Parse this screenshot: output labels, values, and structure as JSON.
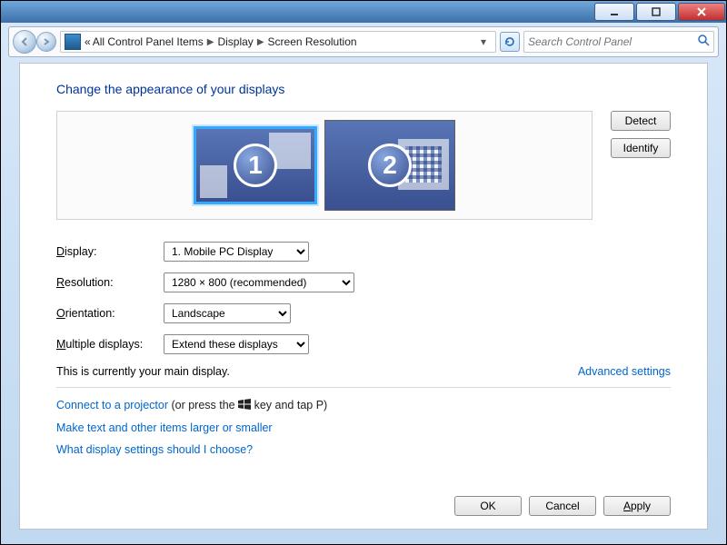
{
  "titlebar": {
    "window_controls": [
      "minimize",
      "maximize",
      "close"
    ]
  },
  "breadcrumb": {
    "prefix": "«",
    "items": [
      "All Control Panel Items",
      "Display",
      "Screen Resolution"
    ]
  },
  "search": {
    "placeholder": "Search Control Panel"
  },
  "heading": "Change the appearance of your displays",
  "preview": {
    "monitors": [
      {
        "id": "1",
        "selected": true
      },
      {
        "id": "2",
        "selected": false
      }
    ],
    "detect_label": "Detect",
    "identify_label": "Identify"
  },
  "form": {
    "display_label": "Display:",
    "display_value": "1. Mobile PC Display",
    "resolution_label": "Resolution:",
    "resolution_value": "1280 × 800 (recommended)",
    "orientation_label": "Orientation:",
    "orientation_value": "Landscape",
    "multiple_label": "Multiple displays:",
    "multiple_value": "Extend these displays"
  },
  "status": {
    "main_display_text": "This is currently your main display.",
    "advanced_link": "Advanced settings"
  },
  "links": {
    "projector_link": "Connect to a projector",
    "projector_hint_before": " (or press the ",
    "projector_hint_after": " key and tap P)",
    "larger_text": "Make text and other items larger or smaller",
    "which_settings": "What display settings should I choose?"
  },
  "footer": {
    "ok": "OK",
    "cancel": "Cancel",
    "apply": "Apply"
  }
}
